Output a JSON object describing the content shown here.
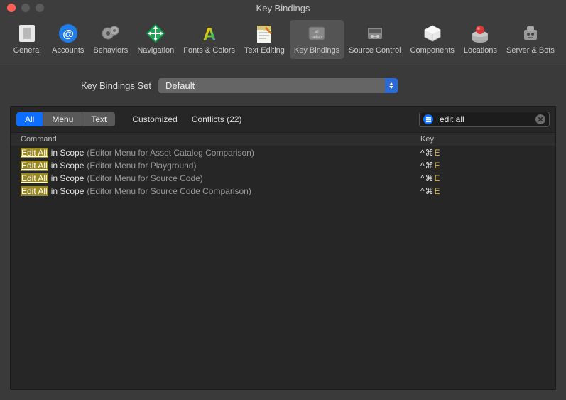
{
  "window": {
    "title": "Key Bindings"
  },
  "toolbar": {
    "items": [
      {
        "label": "General"
      },
      {
        "label": "Accounts"
      },
      {
        "label": "Behaviors"
      },
      {
        "label": "Navigation"
      },
      {
        "label": "Fonts & Colors"
      },
      {
        "label": "Text Editing"
      },
      {
        "label": "Key Bindings"
      },
      {
        "label": "Source Control"
      },
      {
        "label": "Components"
      },
      {
        "label": "Locations"
      },
      {
        "label": "Server & Bots"
      }
    ]
  },
  "set": {
    "label": "Key Bindings Set",
    "value": "Default"
  },
  "filters": {
    "segments": [
      "All",
      "Menu",
      "Text"
    ],
    "customized": "Customized",
    "conflicts": "Conflicts (22)"
  },
  "search": {
    "value": "edit all"
  },
  "columns": {
    "command": "Command",
    "key": "Key"
  },
  "rows": [
    {
      "match": "Edit All",
      "rest": " in Scope",
      "context": "(Editor Menu for Asset Catalog Comparison)",
      "mods": "^⌘",
      "last": "E"
    },
    {
      "match": "Edit All",
      "rest": " in Scope",
      "context": "(Editor Menu for Playground)",
      "mods": "^⌘",
      "last": "E"
    },
    {
      "match": "Edit All",
      "rest": " in Scope",
      "context": "(Editor Menu for Source Code)",
      "mods": "^⌘",
      "last": "E"
    },
    {
      "match": "Edit All",
      "rest": " in Scope",
      "context": "(Editor Menu for Source Code Comparison)",
      "mods": "^⌘",
      "last": "E"
    }
  ]
}
